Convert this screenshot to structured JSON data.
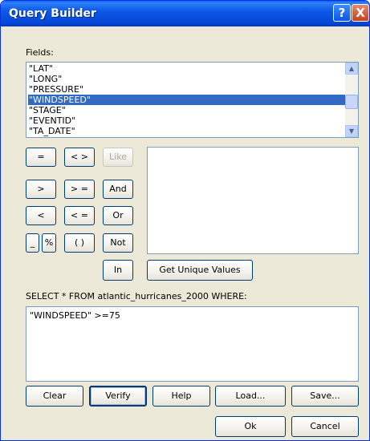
{
  "window": {
    "title": "Query Builder"
  },
  "titlebar_buttons": {
    "help": "?",
    "close": "X"
  },
  "fields_label": "Fields:",
  "fields": [
    {
      "label": "\"LAT\"",
      "selected": false
    },
    {
      "label": "\"LONG\"",
      "selected": false
    },
    {
      "label": "\"PRESSURE\"",
      "selected": false
    },
    {
      "label": "\"WINDSPEED\"",
      "selected": true
    },
    {
      "label": "\"STAGE\"",
      "selected": false
    },
    {
      "label": "\"EVENTID\"",
      "selected": false
    },
    {
      "label": "\"TA_DATE\"",
      "selected": false
    }
  ],
  "operators": {
    "eq": "=",
    "ne": "< >",
    "like": "Like",
    "gt": ">",
    "ge": "> =",
    "and": "And",
    "lt": "<",
    "le": "< =",
    "or": "Or",
    "underscore": "_",
    "percent": "%",
    "parens": "( )",
    "not": "Not",
    "in": "In"
  },
  "get_unique_values": "Get Unique Values",
  "sql_prefix": "SELECT * FROM atlantic_hurricanes_2000 WHERE:",
  "where_clause": "\"WINDSPEED\" >=75",
  "buttons": {
    "clear": "Clear",
    "verify": "Verify",
    "help": "Help",
    "load": "Load...",
    "save": "Save...",
    "ok": "Ok",
    "cancel": "Cancel"
  }
}
